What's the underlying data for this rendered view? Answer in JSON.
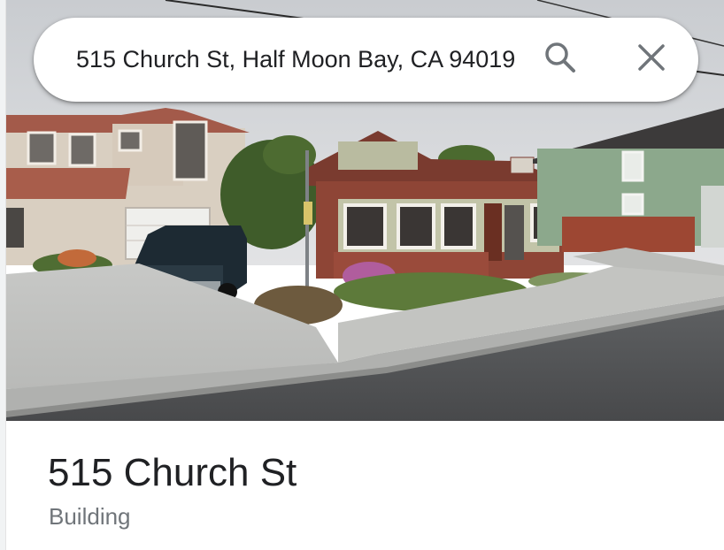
{
  "search": {
    "query": "515 Church St, Half Moon Bay, CA 94019",
    "search_icon": "search-icon",
    "clear_icon": "close-icon"
  },
  "photo": {
    "type": "street-view",
    "subject": "building"
  },
  "place": {
    "title": "515 Church St",
    "category": "Building"
  },
  "colors": {
    "title_text": "#202124",
    "subtitle_text": "#70757a",
    "icon": "#70757a",
    "search_bg": "#ffffff"
  }
}
